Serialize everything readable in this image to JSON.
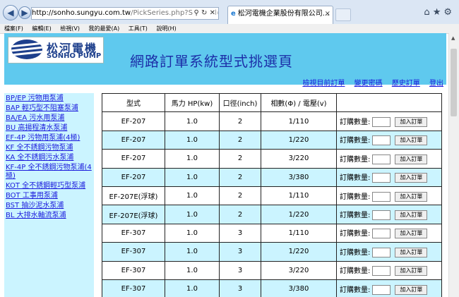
{
  "browser": {
    "address_domain": "http://sonho.sungyu.com.tw",
    "address_rest": "/PickSeries.php?SeriesId=7&Ser",
    "tab_title": "松河電機企業股份有限公司..."
  },
  "menu": [
    "檔案(F)",
    "編輯(E)",
    "檢視(V)",
    "我的最愛(A)",
    "工具(T)",
    "說明(H)"
  ],
  "header": {
    "logo_cn": "松河電機",
    "logo_en": "SONHO PUMP",
    "title": "網路訂單系統型式挑選頁",
    "links": [
      "檢視目前訂單",
      "變更密碼",
      "歷史訂單",
      "登出"
    ]
  },
  "sidebar": [
    "BP/EP 污物用泵浦",
    "BAP 輕巧型不阻塞泵浦",
    "BA/EA 污水用泵浦",
    "BU 高揚程清水泵浦",
    "EF-4P 污物用泵浦(4極)",
    "KF 全不銹鋼污物泵浦",
    "KA 全不銹鋼污水泵浦",
    "KF-4P 全不銹鋼污物泵浦(4極)",
    "KOT 全不銹鋼輕巧型泵浦",
    "BOT 工事用泵浦",
    "BST 抽沙泥水泵浦",
    "BL 大排水軸流泵浦"
  ],
  "table": {
    "headers": [
      "型式",
      "馬力 HP(kw)",
      "口徑(inch)",
      "相數(Φ) / 電壓(v)",
      ""
    ],
    "qty_label": "訂購數量:",
    "button_label": "加入訂單",
    "rows": [
      [
        "EF-207",
        "1.0",
        "2",
        "1/110"
      ],
      [
        "EF-207",
        "1.0",
        "2",
        "1/220"
      ],
      [
        "EF-207",
        "1.0",
        "2",
        "3/220"
      ],
      [
        "EF-207",
        "1.0",
        "2",
        "3/380"
      ],
      [
        "EF-207E(浮球)",
        "1.0",
        "2",
        "1/110"
      ],
      [
        "EF-207E(浮球)",
        "1.0",
        "2",
        "1/220"
      ],
      [
        "EF-307",
        "1.0",
        "3",
        "1/110"
      ],
      [
        "EF-307",
        "1.0",
        "3",
        "1/220"
      ],
      [
        "EF-307",
        "1.0",
        "3",
        "3/220"
      ],
      [
        "EF-307",
        "1.0",
        "3",
        "3/380"
      ]
    ]
  }
}
